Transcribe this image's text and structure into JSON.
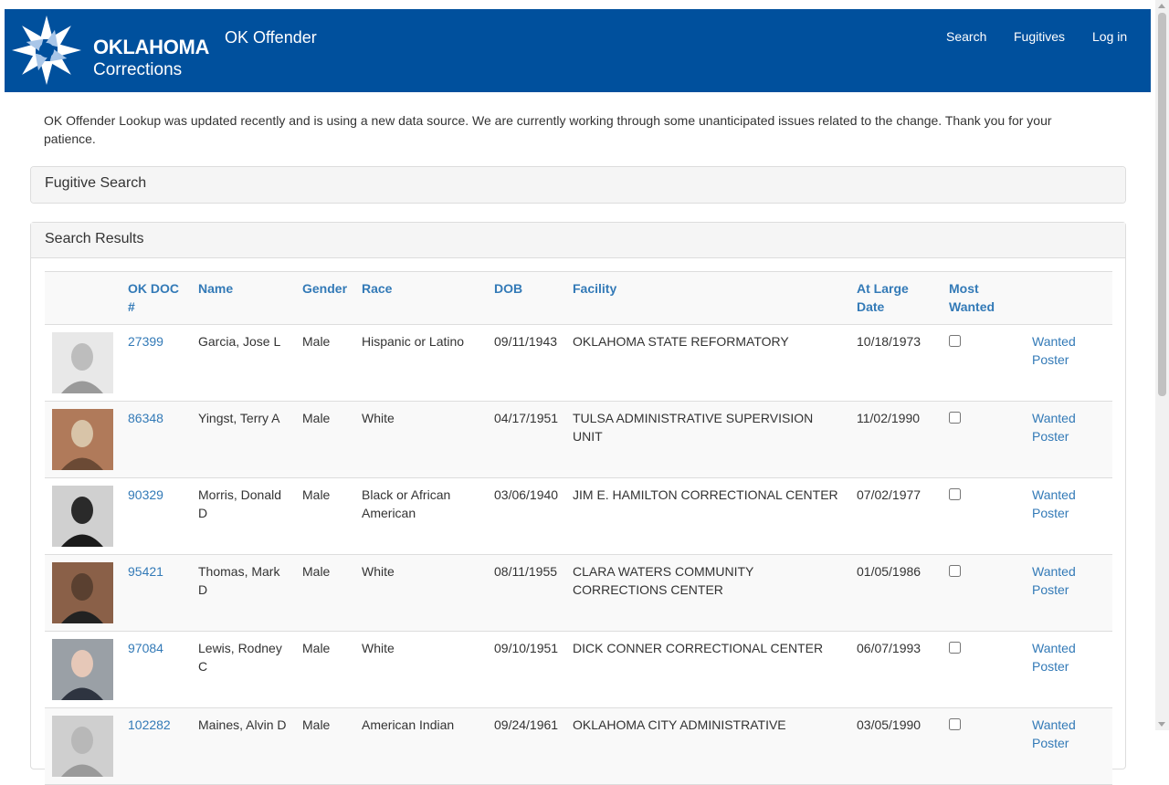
{
  "brand": {
    "name_line1": "OKLAHOMA",
    "name_line2": "Corrections",
    "app_title": "OK Offender",
    "logo_icon": "star-logo-icon",
    "colors": {
      "navbar": "#00509d",
      "link": "#337ab7"
    }
  },
  "nav": {
    "search": "Search",
    "fugitives": "Fugitives",
    "login": "Log in"
  },
  "notice": "OK Offender Lookup was updated recently and is using a new data source.  We are currently working through some unanticipated issues related to the change.  Thank you for your patience.",
  "fugitive_search": {
    "heading": "Fugitive Search"
  },
  "results": {
    "heading": "Search Results",
    "columns": {
      "doc": "OK DOC #",
      "name": "Name",
      "gender": "Gender",
      "race": "Race",
      "dob": "DOB",
      "facility": "Facility",
      "at_large": "At Large Date",
      "most_wanted": "Most Wanted"
    },
    "poster_label": "Wanted Poster",
    "rows": [
      {
        "doc": "27399",
        "name": "Garcia, Jose L",
        "gender": "Male",
        "race": "Hispanic or Latino",
        "dob": "09/11/1943",
        "facility": "OKLAHOMA STATE REFORMATORY",
        "at_large": "10/18/1973",
        "most_wanted": false
      },
      {
        "doc": "86348",
        "name": "Yingst, Terry A",
        "gender": "Male",
        "race": "White",
        "dob": "04/17/1951",
        "facility": "TULSA ADMINISTRATIVE SUPERVISION UNIT",
        "at_large": "11/02/1990",
        "most_wanted": false
      },
      {
        "doc": "90329",
        "name": "Morris, Donald D",
        "gender": "Male",
        "race": "Black or African American",
        "dob": "03/06/1940",
        "facility": "JIM E. HAMILTON CORRECTIONAL CENTER",
        "at_large": "07/02/1977",
        "most_wanted": false
      },
      {
        "doc": "95421",
        "name": "Thomas, Mark D",
        "gender": "Male",
        "race": "White",
        "dob": "08/11/1955",
        "facility": "CLARA WATERS COMMUNITY CORRECTIONS CENTER",
        "at_large": "01/05/1986",
        "most_wanted": false
      },
      {
        "doc": "97084",
        "name": "Lewis, Rodney C",
        "gender": "Male",
        "race": "White",
        "dob": "09/10/1951",
        "facility": "DICK CONNER CORRECTIONAL CENTER",
        "at_large": "06/07/1993",
        "most_wanted": false
      },
      {
        "doc": "102282",
        "name": "Maines, Alvin D",
        "gender": "Male",
        "race": "American Indian",
        "dob": "09/24/1961",
        "facility": "OKLAHOMA CITY ADMINISTRATIVE",
        "at_large": "03/05/1990",
        "most_wanted": false
      }
    ]
  }
}
